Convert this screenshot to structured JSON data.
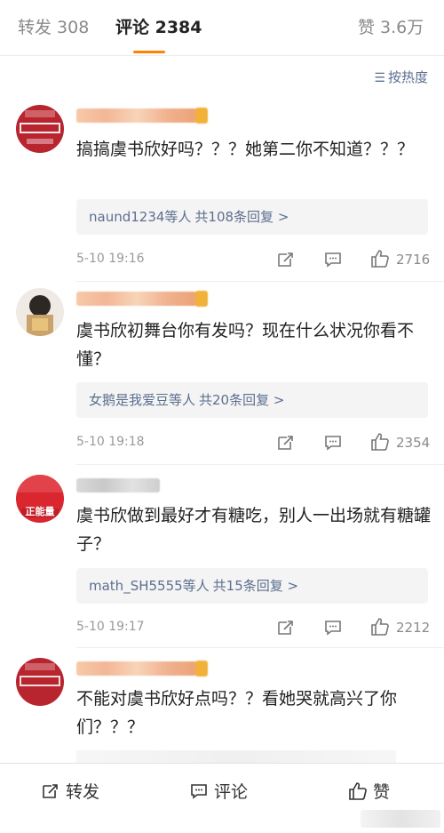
{
  "tabs": {
    "repost": "转发 308",
    "comments": "评论 2384",
    "likes": "赞 3.6万"
  },
  "sort": {
    "label": "按热度"
  },
  "comments": [
    {
      "text": "搞搞虞书欣好吗？？？她第二你不知道？？？",
      "reply_names": "naund1234等人",
      "reply_count": "共108条回复 >",
      "time": "5-10 19:16",
      "likes": "2716"
    },
    {
      "text": "虞书欣初舞台你有发吗？现在什么状况你看不懂？",
      "reply_names": "女鹅是我爱豆等人",
      "reply_count": "共20条回复 >",
      "time": "5-10 19:18",
      "likes": "2354"
    },
    {
      "text": "虞书欣做到最好才有糖吃，别人一出场就有糖罐子？",
      "reply_names": "math_SH5555等人",
      "reply_count": "共15条回复 >",
      "time": "5-10 19:17",
      "likes": "2212",
      "avatar_text": "正能量"
    },
    {
      "text": "不能对虞书欣好点吗？？看她哭就高兴了你们？？？"
    }
  ],
  "bottom_bar": {
    "repost": "转发",
    "comment": "评论",
    "like": "赞"
  },
  "colors": {
    "accent": "#ff8200",
    "link": "#5d6f8f",
    "muted": "#9a9a9a"
  }
}
